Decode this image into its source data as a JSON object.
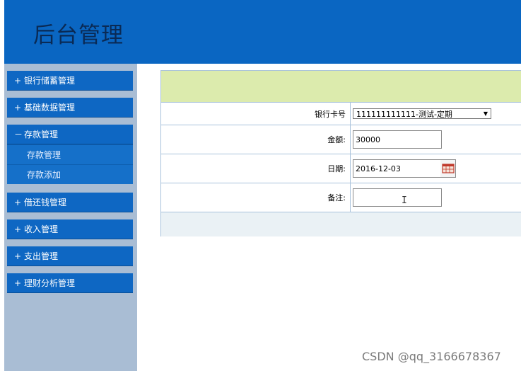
{
  "header": {
    "title": "后台管理"
  },
  "sidebar": {
    "items": [
      {
        "sign": "+",
        "label": "银行储蓄管理"
      },
      {
        "sign": "+",
        "label": "基础数据管理"
      },
      {
        "sign": "－",
        "label": "存款管理"
      },
      {
        "sign": "+",
        "label": "借还钱管理"
      },
      {
        "sign": "+",
        "label": "收入管理"
      },
      {
        "sign": "+",
        "label": "支出管理"
      },
      {
        "sign": "+",
        "label": "理财分析管理"
      }
    ],
    "submenu": [
      {
        "label": "存款管理"
      },
      {
        "label": "存款添加"
      }
    ]
  },
  "form": {
    "card_label": "银行卡号",
    "card_value": "111111111111-测试-定期",
    "amount_label": "金额:",
    "amount_value": "30000",
    "date_label": "日期:",
    "date_value": "2016-12-03",
    "note_label": "备注:",
    "note_value": ""
  },
  "cursor": "I",
  "watermark": "CSDN @qq_3166678367",
  "colors": {
    "header_bg": "#0a66c2",
    "menu_bg": "#0e67c3",
    "sidebar_bg": "#a9bdd4",
    "form_header_bg": "#dcebad"
  }
}
